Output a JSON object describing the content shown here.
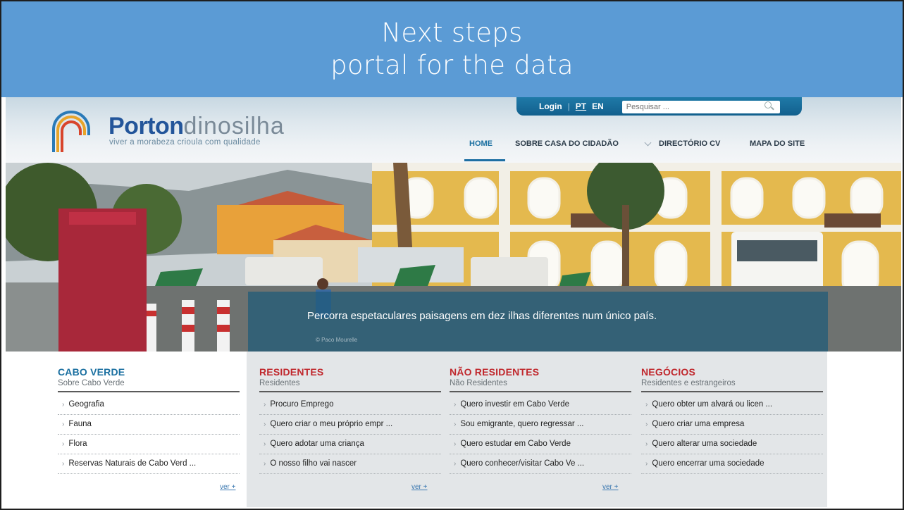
{
  "slide": {
    "title_line1": "Next steps",
    "title_line2": "portal for the data"
  },
  "site": {
    "brand_bold": "Porton",
    "brand_light": "dinosilha",
    "tagline": "viver a morabeza crioula com qualidade",
    "topbar": {
      "login": "Login",
      "separator": "|",
      "lang_pt": "PT",
      "lang_en": "EN",
      "search_placeholder": "Pesquisar ..."
    },
    "nav": [
      {
        "label": "HOME"
      },
      {
        "label": "SOBRE CASA DO CIDADÃO"
      },
      {
        "label": "DIRECTÓRIO CV"
      },
      {
        "label": "MAPA DO SITE"
      }
    ],
    "hero": {
      "caption": "Percorra espetaculares paisagens em dez ilhas diferentes num único país.",
      "credit": "© Paco Mourelle"
    },
    "columns": [
      {
        "title": "CABO VERDE",
        "subtitle": "Sobre Cabo Verde",
        "items": [
          "Geografia",
          "Fauna",
          "Flora",
          "Reservas Naturais de Cabo Verd ..."
        ],
        "more": "ver +"
      },
      {
        "title": "RESIDENTES",
        "subtitle": "Residentes",
        "items": [
          "Procuro Emprego",
          "Quero criar o meu próprio empr ...",
          "Quero adotar uma criança",
          "O nosso filho vai nascer"
        ],
        "more": "ver +"
      },
      {
        "title": "NÃO RESIDENTES",
        "subtitle": "Não Residentes",
        "items": [
          "Quero investir em Cabo Verde",
          "Sou emigrante, quero regressar ...",
          "Quero estudar em Cabo Verde",
          "Quero conhecer/visitar Cabo Ve ..."
        ],
        "more": "ver +"
      },
      {
        "title": "NEGÓCIOS",
        "subtitle": "Residentes e estrangeiros",
        "items": [
          "Quero obter um alvará ou licen ...",
          "Quero criar uma empresa",
          "Quero alterar uma sociedade",
          "Quero encerrar uma sociedade"
        ],
        "more": ""
      }
    ]
  },
  "colors": {
    "title_bar": "#5b9bd5",
    "brand_blue": "#23559a",
    "nav_accent": "#1e6fa3",
    "heading_red": "#c0282d",
    "heading_blue": "#1a6fa0"
  }
}
